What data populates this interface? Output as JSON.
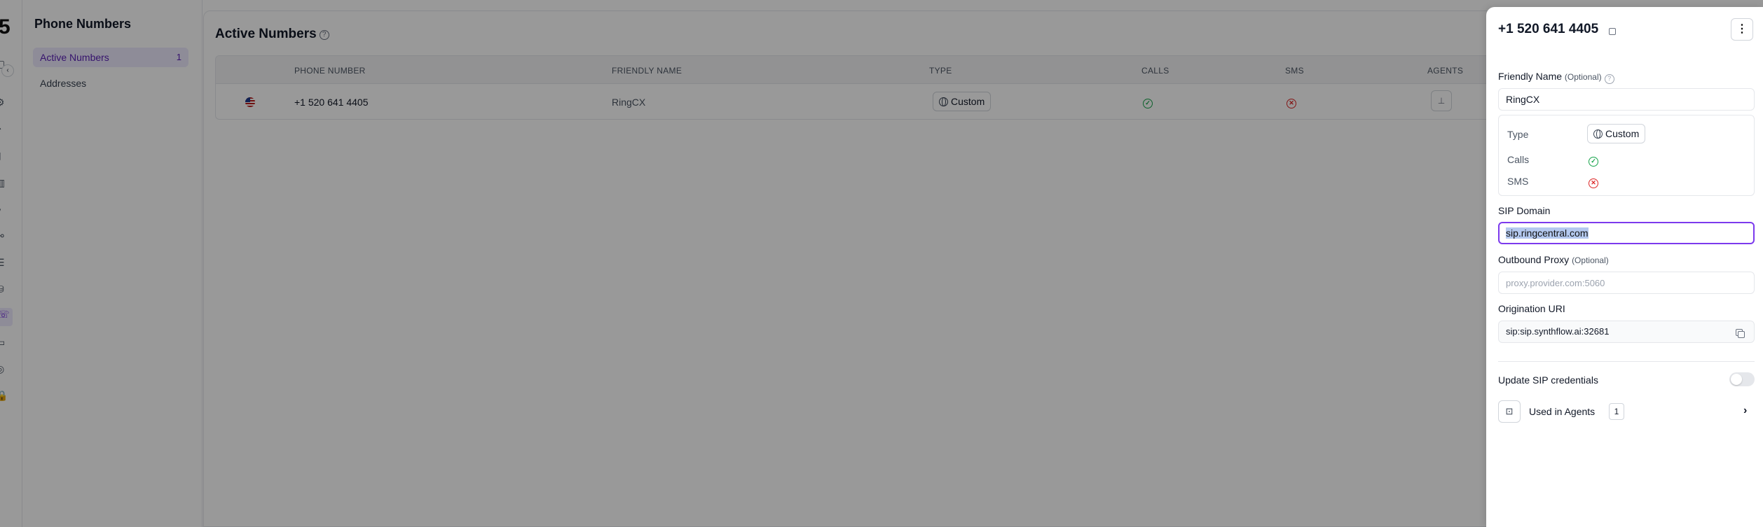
{
  "sidebar": {
    "logo": "5"
  },
  "subnav": {
    "title": "Phone Numbers",
    "items": [
      {
        "label": "Active Numbers",
        "count": "1"
      },
      {
        "label": "Addresses"
      }
    ]
  },
  "main": {
    "title": "Active Numbers",
    "columns": [
      "PHONE NUMBER",
      "FRIENDLY NAME",
      "TYPE",
      "CALLS",
      "SMS",
      "AGENTS"
    ],
    "rows": [
      {
        "phone": "+1 520 641 4405",
        "friendly_name": "RingCX",
        "type": "Custom",
        "calls": "enabled",
        "sms": "disabled"
      }
    ]
  },
  "drawer": {
    "title": "+1 520 641 4405",
    "friendly_name_label": "Friendly Name",
    "optional_text": "(Optional)",
    "friendly_name_value": "RingCX",
    "info": {
      "type_label": "Type",
      "type_value": "Custom",
      "calls_label": "Calls",
      "sms_label": "SMS"
    },
    "sip_domain_label": "SIP Domain",
    "sip_domain_value": "sip.ringcentral.com",
    "outbound_proxy_label": "Outbound Proxy",
    "outbound_proxy_placeholder": "proxy.provider.com:5060",
    "origination_uri_label": "Origination URI",
    "origination_uri_value": "sip:sip.synthflow.ai:32681",
    "update_sip_label": "Update SIP credentials",
    "update_sip_enabled": false,
    "used_in_agents_label": "Used in Agents",
    "used_in_agents_count": "1"
  },
  "colors": {
    "accent": "#7c3aed",
    "success": "#16a34a",
    "danger": "#dc2626"
  }
}
